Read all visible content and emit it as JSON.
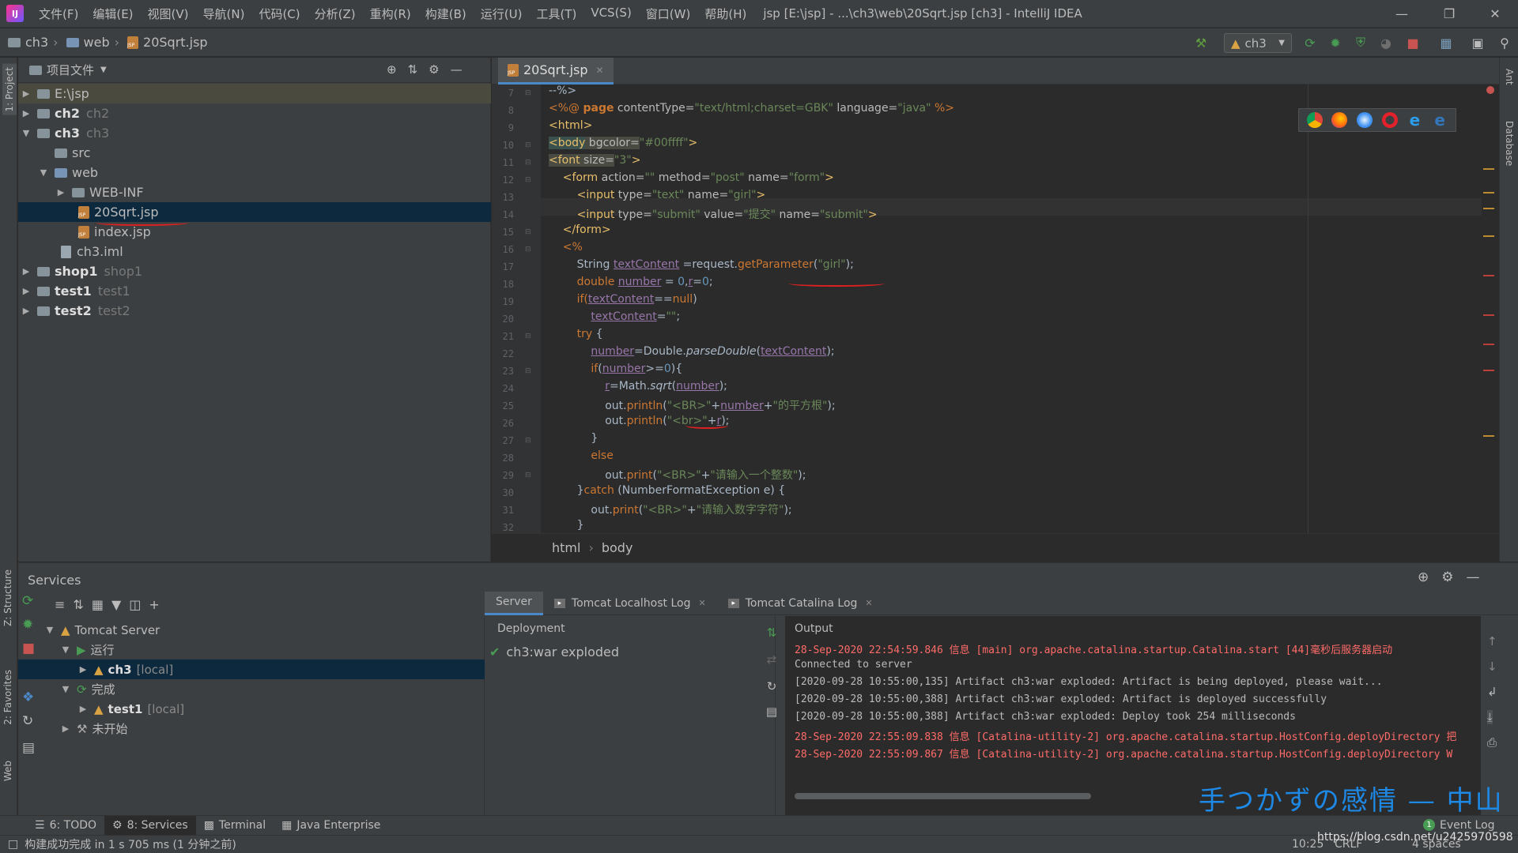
{
  "menu": [
    "文件(F)",
    "编辑(E)",
    "视图(V)",
    "导航(N)",
    "代码(C)",
    "分析(Z)",
    "重构(R)",
    "构建(B)",
    "运行(U)",
    "工具(T)",
    "VCS(S)",
    "窗口(W)",
    "帮助(H)"
  ],
  "window_title": "jsp [E:\\jsp] - ...\\ch3\\web\\20Sqrt.jsp [ch3] - IntelliJ IDEA",
  "breadcrumb": [
    "ch3",
    "web",
    "20Sqrt.jsp"
  ],
  "run_config": "ch3",
  "left_stripe": {
    "project": "1: Project",
    "structure": "Z: Structure",
    "favorites": "2: Favorites",
    "web": "Web"
  },
  "right_stripe": {
    "ant": "Ant",
    "database": "Database"
  },
  "project": {
    "header": "项目文件",
    "tree": [
      {
        "label": "E:\\jsp",
        "sub": ""
      },
      {
        "label": "ch2",
        "sub": "ch2"
      },
      {
        "label": "ch3",
        "sub": "ch3"
      },
      {
        "label": "src",
        "sub": ""
      },
      {
        "label": "web",
        "sub": ""
      },
      {
        "label": "WEB-INF",
        "sub": ""
      },
      {
        "label": "20Sqrt.jsp",
        "sub": ""
      },
      {
        "label": "index.jsp",
        "sub": ""
      },
      {
        "label": "ch3.iml",
        "sub": ""
      },
      {
        "label": "shop1",
        "sub": "shop1"
      },
      {
        "label": "test1",
        "sub": "test1"
      },
      {
        "label": "test2",
        "sub": "test2"
      }
    ]
  },
  "editor": {
    "tab": "20Sqrt.jsp",
    "line_numbers": [
      "7",
      "8",
      "9",
      "10",
      "11",
      "12",
      "13",
      "14",
      "15",
      "16",
      "17",
      "18",
      "19",
      "20",
      "21",
      "22",
      "23",
      "24",
      "25",
      "26",
      "27",
      "28",
      "29",
      "30",
      "31",
      "32"
    ],
    "code": {
      "l7": "--%>",
      "l8a": "<%@ ",
      "l8b": "page",
      "l8c": " contentType=",
      "l8d": "\"text/html;charset=GBK\"",
      "l8e": " language=",
      "l8f": "\"java\"",
      "l8g": " %>",
      "l9": "<html>",
      "l10a": "<body",
      "l10b": " bgcolor=",
      "l10c": "\"#00ffff\"",
      "l10d": ">",
      "l11a": "<font",
      "l11b": " size=",
      "l11c": "\"3\"",
      "l11d": ">",
      "l12a": "    <form",
      "l12b": " action=",
      "l12c": "\"\"",
      "l12d": " method=",
      "l12e": "\"post\"",
      "l12f": " name=",
      "l12g": "\"form\"",
      "l12h": ">",
      "l13a": "        <input",
      "l13b": " type=",
      "l13c": "\"text\"",
      "l13d": " name=",
      "l13e": "\"girl\"",
      "l13f": ">",
      "l14a": "        <input",
      "l14b": " type=",
      "l14c": "\"submit\"",
      "l14d": " value=",
      "l14e": "\"提交\"",
      "l14f": " name=",
      "l14g": "\"submit\"",
      "l14h": ">",
      "l15": "    </form>",
      "l16": "    <%",
      "l17a": "        String ",
      "l17b": "textContent",
      "l17c": " =request.",
      "l17d": "getParameter",
      "l17e": "(",
      "l17f": "\"girl\"",
      "l17g": ");",
      "l18a": "        double ",
      "l18b": "number",
      "l18c": " = ",
      "l18d": "0",
      "l18e": ",",
      "l18f": "r",
      "l18g": "=",
      "l18h": "0",
      "l18i": ";",
      "l19a": "        if(",
      "l19b": "textContent",
      "l19c": "==",
      "l19d": "null",
      "l19e": ")",
      "l20a": "            ",
      "l20b": "textContent",
      "l20c": "=",
      "l20d": "\"\"",
      "l20e": ";",
      "l21a": "        ",
      "l21b": "try",
      "l21c": " {",
      "l22a": "            ",
      "l22b": "number",
      "l22c": "=Double.",
      "l22d": "parseDouble",
      "l22e": "(",
      "l22f": "textContent",
      "l22g": ");",
      "l23a": "            ",
      "l23b": "if",
      "l23c": "(",
      "l23d": "number",
      "l23e": ">=",
      "l23f": "0",
      "l23g": "){",
      "l24a": "                ",
      "l24b": "r",
      "l24c": "=Math.",
      "l24d": "sqrt",
      "l24e": "(",
      "l24f": "number",
      "l24g": ");",
      "l25a": "                out.",
      "l25b": "println",
      "l25c": "(",
      "l25d": "\"<BR>\"",
      "l25e": "+",
      "l25f": "number",
      "l25g": "+",
      "l25h": "\"的平方根\"",
      "l25i": ");",
      "l26a": "                out.",
      "l26b": "println",
      "l26c": "(",
      "l26d": "\"<br>\"",
      "l26e": "+",
      "l26f": "r",
      "l26g": ");",
      "l27": "            }",
      "l28a": "            ",
      "l28b": "else",
      "l29a": "                out.",
      "l29b": "print",
      "l29c": "(",
      "l29d": "\"<BR>\"",
      "l29e": "+",
      "l29f": "\"请输入一个整数\"",
      "l29g": ");",
      "l30a": "        }",
      "l30b": "catch",
      "l30c": " (NumberFormatException e) {",
      "l31a": "            out.",
      "l31b": "print",
      "l31c": "(",
      "l31d": "\"<BR>\"",
      "l31e": "+",
      "l31f": "\"请输入数字字符\"",
      "l31g": ");",
      "l32": "        }"
    },
    "crumbs": [
      "html",
      "body"
    ]
  },
  "services": {
    "title": "Services",
    "tree": [
      {
        "label": "Tomcat Server",
        "sub": ""
      },
      {
        "label": "运行",
        "sub": ""
      },
      {
        "label": "ch3",
        "sub": "[local]"
      },
      {
        "label": "完成",
        "sub": ""
      },
      {
        "label": "test1",
        "sub": "[local]"
      },
      {
        "label": "未开始",
        "sub": ""
      }
    ],
    "tabs": [
      "Server",
      "Tomcat Localhost Log",
      "Tomcat Catalina Log"
    ],
    "deployment_header": "Deployment",
    "deployment_item": "ch3:war exploded",
    "output_header": "Output",
    "output": [
      {
        "text": "28-Sep-2020 22:54:59.846 信息 [main] org.apache.catalina.startup.Catalina.start [44]毫秒后服务器启动",
        "level": "red"
      },
      {
        "text": "Connected to server",
        "level": "normal"
      },
      {
        "text": "[2020-09-28 10:55:00,135] Artifact ch3:war exploded: Artifact is being deployed, please wait...",
        "level": "normal"
      },
      {
        "text": "[2020-09-28 10:55:00,388] Artifact ch3:war exploded: Artifact is deployed successfully",
        "level": "normal"
      },
      {
        "text": "[2020-09-28 10:55:00,388] Artifact ch3:war exploded: Deploy took 254 milliseconds",
        "level": "normal"
      },
      {
        "text": "28-Sep-2020 22:55:09.838 信息 [Catalina-utility-2] org.apache.catalina.startup.HostConfig.deployDirectory 把",
        "level": "red"
      },
      {
        "text": "28-Sep-2020 22:55:09.867 信息 [Catalina-utility-2] org.apache.catalina.startup.HostConfig.deployDirectory W",
        "level": "red"
      }
    ],
    "watermark": "手つかずの感情 — 中山"
  },
  "tool_tabs": [
    "6: TODO",
    "8: Services",
    "Terminal",
    "Java Enterprise"
  ],
  "event_log": "Event Log",
  "event_badge": "1",
  "status": {
    "message": "构建成功完成 in 1 s 705 ms (1 分钟之前)",
    "position": "10:25",
    "line_sep": "CRLF",
    "indent": "4 spaces",
    "url": "https://blog.csdn.net/u2425970598"
  },
  "colors": {
    "accent": "#4a88c7",
    "selection": "#0d293e",
    "error": "#ff6b68",
    "success": "#499c54"
  }
}
